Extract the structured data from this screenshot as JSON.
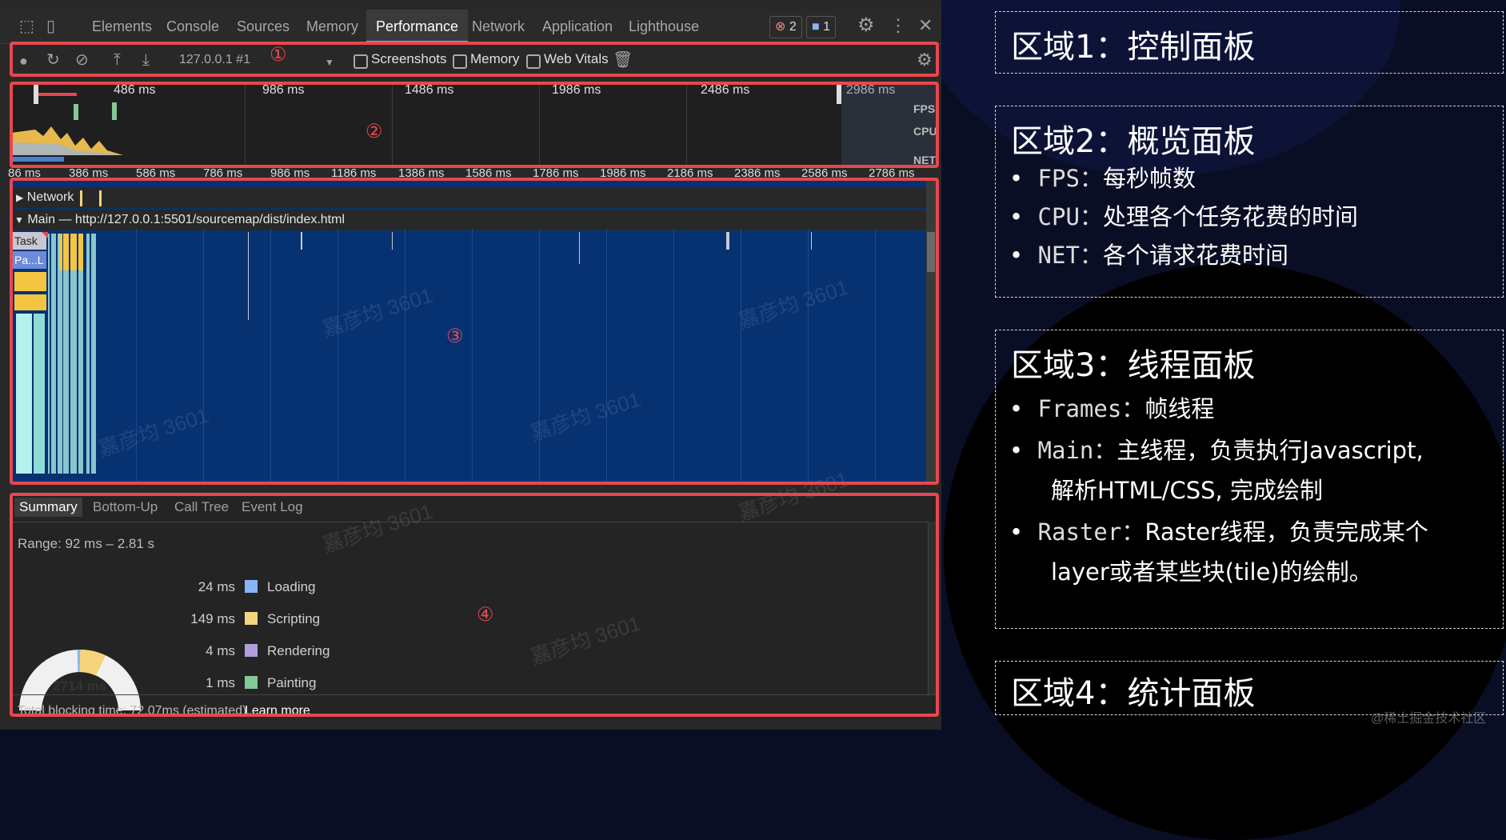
{
  "devtools": {
    "tabs": [
      "Elements",
      "Console",
      "Sources",
      "Memory",
      "Performance",
      "Network",
      "Application",
      "Lighthouse"
    ],
    "active_tab": "Performance",
    "error_count": "2",
    "message_count": "1"
  },
  "control": {
    "target": "127.0.0.1 #1",
    "screenshots_label": "Screenshots",
    "memory_label": "Memory",
    "web_vitals_label": "Web Vitals"
  },
  "overview": {
    "ticks": [
      "486 ms",
      "986 ms",
      "1486 ms",
      "1986 ms",
      "2486 ms",
      "2986 ms"
    ],
    "labels": [
      "FPS",
      "CPU",
      "NET"
    ]
  },
  "timeline": {
    "ticks": [
      "86 ms",
      "386 ms",
      "586 ms",
      "786 ms",
      "986 ms",
      "1186 ms",
      "1386 ms",
      "1586 ms",
      "1786 ms",
      "1986 ms",
      "2186 ms",
      "2386 ms",
      "2586 ms",
      "2786 ms"
    ]
  },
  "threads": {
    "network_label": "Network",
    "main_label": "Main — http://127.0.0.1:5501/sourcemap/dist/index.html",
    "task_label": "Task",
    "pal_label": "Pa...L"
  },
  "summary": {
    "tabs": [
      "Summary",
      "Bottom-Up",
      "Call Tree",
      "Event Log"
    ],
    "range": "Range: 92 ms – 2.81 s",
    "items": [
      {
        "value": "24 ms",
        "label": "Loading",
        "color": "#8ab4f8"
      },
      {
        "value": "149 ms",
        "label": "Scripting",
        "color": "#f5d47a"
      },
      {
        "value": "4 ms",
        "label": "Rendering",
        "color": "#b39ddb"
      },
      {
        "value": "1 ms",
        "label": "Painting",
        "color": "#81c995"
      }
    ],
    "total": "2714 ms",
    "blocking": "Total blocking time: 72.07ms (estimated)",
    "learn_more": "Learn more"
  },
  "markers": [
    "①",
    "②",
    "③",
    "④"
  ],
  "annotations": {
    "area1": {
      "title": "区域1：控制面板"
    },
    "area2": {
      "title": "区域2：概览面板",
      "bullets": [
        {
          "key": "FPS：",
          "text": "每秒帧数"
        },
        {
          "key": "CPU：",
          "text": "处理各个任务花费的时间"
        },
        {
          "key": "NET：",
          "text": "各个请求花费时间"
        }
      ]
    },
    "area3": {
      "title": "区域3：线程面板",
      "bullets": [
        {
          "key": "Frames：",
          "text": "帧线程"
        },
        {
          "key": "Main：",
          "text": "主线程，负责执行Javascript,"
        },
        {
          "key": "",
          "text": "解析HTML/CSS, 完成绘制"
        },
        {
          "key": "Raster：",
          "text": "Raster线程，负责完成某个"
        },
        {
          "key": "",
          "text": "layer或者某些块(tile)的绘制。"
        }
      ]
    },
    "area4": {
      "title": "区域4：统计面板"
    }
  },
  "watermark": "嘉彦均 3601",
  "credit": "@稀土掘金技术社区"
}
